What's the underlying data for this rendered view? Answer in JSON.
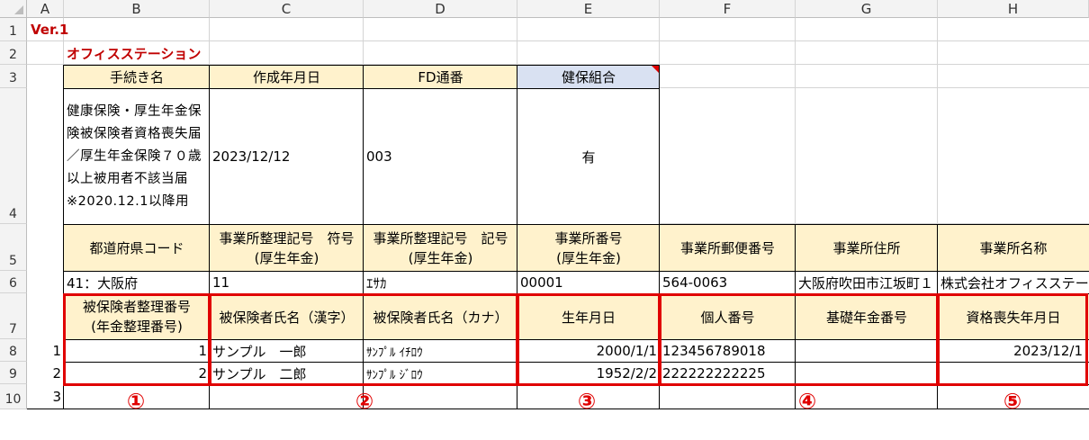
{
  "columns": [
    "A",
    "B",
    "C",
    "D",
    "E",
    "F",
    "G",
    "H"
  ],
  "rows": [
    "1",
    "2",
    "3",
    "4",
    "5",
    "6",
    "7",
    "8",
    "9",
    "10"
  ],
  "version": "Ver.1",
  "brand": "オフィスステーション",
  "header1": {
    "procedure": "手続き名",
    "created": "作成年月日",
    "fd": "FD通番",
    "union": "健保組合"
  },
  "values1": {
    "procedure": "健康保険・厚生年金保険被保険者資格喪失届／厚生年金保険７０歳以上被用者不該当届　※2020.12.1以降用",
    "created": "2023/12/12",
    "fd": "003",
    "union": "有"
  },
  "header2": {
    "pref": "都道府県コード",
    "code_sym": "事業所整理記号　符号\n(厚生年金)",
    "code_rec": "事業所整理記号　記号\n(厚生年金)",
    "office_no": "事業所番号\n(厚生年金)",
    "zip": "事業所郵便番号",
    "address": "事業所住所",
    "name": "事業所名称"
  },
  "values2": {
    "pref": "41：大阪府",
    "code_sym": "11",
    "code_rec": "ｴｻｶ",
    "office_no": "00001",
    "zip": "564-0063",
    "address": "大阪府吹田市江坂町１",
    "name": "株式会社オフィスステー"
  },
  "header3": {
    "insured_no": "被保険者整理番号\n(年金整理番号)",
    "name_kanji": "被保険者氏名（漢字）",
    "name_kana": "被保険者氏名（カナ）",
    "birth": "生年月日",
    "personal_no": "個人番号",
    "pension_no": "基礎年金番号",
    "loss_date": "資格喪失年月日"
  },
  "data_rows": [
    {
      "a": "1",
      "insured_no": "1",
      "name_kanji": "サンプル　一郎",
      "name_kana": "ｻﾝﾌﾟﾙ ｲﾁﾛｳ",
      "birth": "2000/1/1",
      "personal_no": "123456789018",
      "pension_no": "",
      "loss_date": "2023/12/1"
    },
    {
      "a": "2",
      "insured_no": "2",
      "name_kanji": "サンプル　二郎",
      "name_kana": "ｻﾝﾌﾟﾙ ｼﾞﾛｳ",
      "birth": "1952/2/2",
      "personal_no": "222222222225",
      "pension_no": "",
      "loss_date": ""
    },
    {
      "a": "3"
    }
  ],
  "markers": [
    "①",
    "②",
    "③",
    "④",
    "⑤"
  ],
  "colors": {
    "accent_red": "#e00000",
    "header_yellow": "#fff2cc",
    "header_blue": "#d9e1f2"
  }
}
